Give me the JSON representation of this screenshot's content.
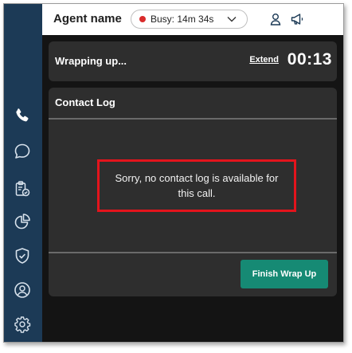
{
  "header": {
    "agent_name": "Agent name",
    "status": {
      "label": "Busy: 14m 34s",
      "color": "#d92b2b"
    },
    "icons": [
      "person-icon",
      "megaphone-icon"
    ]
  },
  "sidebar": {
    "icons": [
      "phone-icon",
      "chat-icon",
      "clipboard-check-icon",
      "pie-chart-icon",
      "shield-check-icon",
      "user-circle-icon",
      "settings-gear-icon"
    ],
    "active": "phone-icon"
  },
  "wrapup": {
    "title": "Wrapping up...",
    "extend_label": "Extend",
    "timer": "00:13"
  },
  "contact_log": {
    "title": "Contact Log",
    "empty_message": "Sorry, no contact log is available for this call.",
    "finish_button": "Finish Wrap Up"
  },
  "colors": {
    "rail": "#1c3a56",
    "panel": "#2e2e2e",
    "accent_button": "#168a74",
    "highlight_box": "#e3141c"
  }
}
